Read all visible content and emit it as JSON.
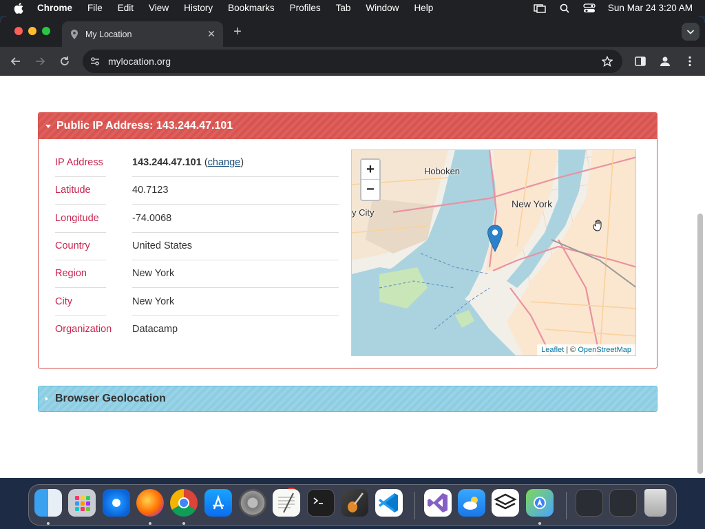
{
  "menubar": {
    "app": "Chrome",
    "items": [
      "File",
      "Edit",
      "View",
      "History",
      "Bookmarks",
      "Profiles",
      "Tab",
      "Window",
      "Help"
    ],
    "clock": "Sun Mar 24  3:20 AM"
  },
  "browser": {
    "tab_title": "My Location",
    "url": "mylocation.org"
  },
  "panel": {
    "title": "Public IP Address: 143.244.47.101",
    "rows": [
      {
        "label": "IP Address",
        "value": "143.244.47.101",
        "link": "change"
      },
      {
        "label": "Latitude",
        "value": "40.7123"
      },
      {
        "label": "Longitude",
        "value": "-74.0068"
      },
      {
        "label": "Country",
        "value": "United States"
      },
      {
        "label": "Region",
        "value": "New York"
      },
      {
        "label": "City",
        "value": "New York"
      },
      {
        "label": "Organization",
        "value": "Datacamp"
      }
    ]
  },
  "map": {
    "zoom_in": "+",
    "zoom_out": "−",
    "labels": {
      "hoboken": "Hoboken",
      "newyork": "New York",
      "jersey": "y City"
    },
    "attribution": {
      "leaflet": "Leaflet",
      "sep": " | © ",
      "osm": "OpenStreetMap"
    }
  },
  "panel2": {
    "title": "Browser Geolocation"
  },
  "dock": {
    "badge": "2"
  },
  "colors": {
    "label": "#c7254e",
    "panel_header": "#d9534f",
    "panel2": "#8ccde3"
  }
}
